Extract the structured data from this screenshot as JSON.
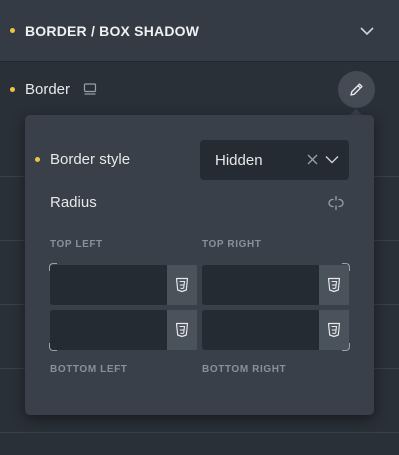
{
  "section": {
    "title": "BORDER / BOX SHADOW",
    "dot_color": "#f0c43f"
  },
  "border_row": {
    "label": "Border",
    "device_icon": "monitor-icon",
    "edit_icon": "pencil-icon"
  },
  "popup": {
    "border_style_label": "Border style",
    "border_style_value": "Hidden",
    "radius_label": "Radius",
    "link_icon": "link-icon",
    "corners": {
      "top_left": {
        "label": "TOP LEFT",
        "value": ""
      },
      "top_right": {
        "label": "TOP RIGHT",
        "value": ""
      },
      "bottom_left": {
        "label": "BOTTOM LEFT",
        "value": ""
      },
      "bottom_right": {
        "label": "BOTTOM RIGHT",
        "value": ""
      }
    },
    "css_icon": "css3-icon"
  }
}
